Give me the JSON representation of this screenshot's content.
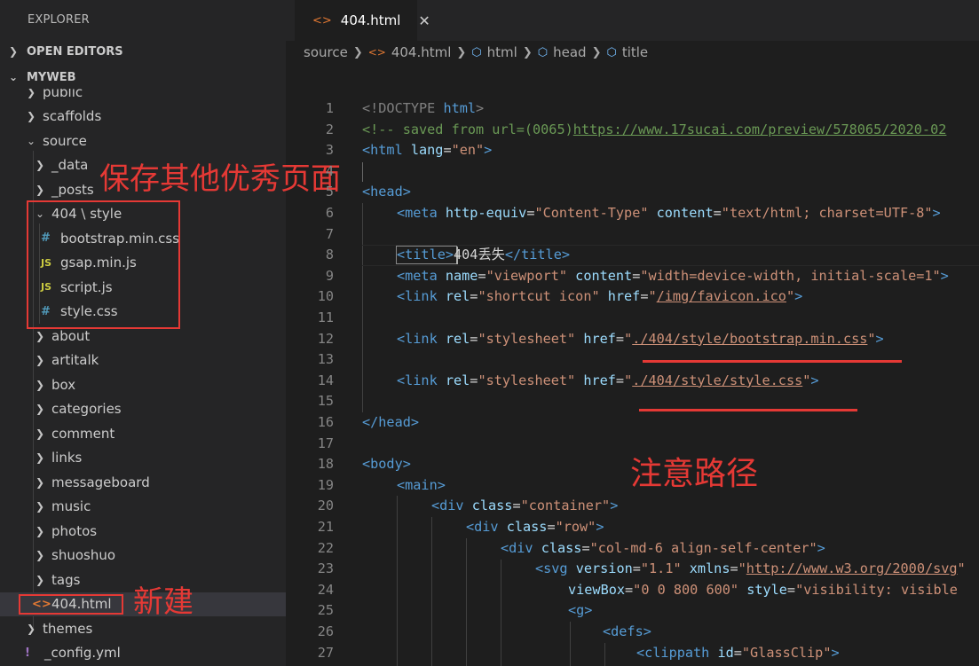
{
  "sidebar": {
    "title": "EXPLORER",
    "open_editors": "OPEN EDITORS",
    "project": "MYWEB",
    "tree": [
      {
        "label": "public",
        "type": "folder"
      },
      {
        "label": "scaffolds",
        "type": "folder"
      },
      {
        "label": "source",
        "type": "folder-open"
      },
      {
        "label": "_data",
        "type": "folder"
      },
      {
        "label": "_posts",
        "type": "folder"
      },
      {
        "label": "404 \\ style",
        "type": "folder-open"
      },
      {
        "label": "bootstrap.min.css",
        "type": "css",
        "icon": "#"
      },
      {
        "label": "gsap.min.js",
        "type": "js",
        "icon": "JS"
      },
      {
        "label": "script.js",
        "type": "js",
        "icon": "JS"
      },
      {
        "label": "style.css",
        "type": "css",
        "icon": "#"
      },
      {
        "label": "about",
        "type": "folder"
      },
      {
        "label": "artitalk",
        "type": "folder"
      },
      {
        "label": "box",
        "type": "folder"
      },
      {
        "label": "categories",
        "type": "folder"
      },
      {
        "label": "comment",
        "type": "folder"
      },
      {
        "label": "links",
        "type": "folder"
      },
      {
        "label": "messageboard",
        "type": "folder"
      },
      {
        "label": "music",
        "type": "folder"
      },
      {
        "label": "photos",
        "type": "folder"
      },
      {
        "label": "shuoshuo",
        "type": "folder"
      },
      {
        "label": "tags",
        "type": "folder"
      },
      {
        "label": "404.html",
        "type": "html",
        "icon": "<>"
      },
      {
        "label": "themes",
        "type": "folder"
      },
      {
        "label": "_config.yml",
        "type": "yml",
        "icon": "!"
      }
    ]
  },
  "annotations": {
    "save_note": "保存其他优秀页面",
    "new_note": "新建",
    "path_note": "注意路径",
    "color": "#e53935"
  },
  "editor": {
    "tab_label": "404.html",
    "tab_icon": "<>",
    "close_icon": "✕",
    "breadcrumb": [
      "source",
      "404.html",
      "html",
      "head",
      "title"
    ],
    "line_numbers": [
      "1",
      "2",
      "3",
      "4",
      "5",
      "6",
      "7",
      "8",
      "9",
      "10",
      "11",
      "12",
      "13",
      "14",
      "15",
      "16",
      "17",
      "18",
      "19",
      "20",
      "21",
      "22",
      "23",
      "24",
      "25",
      "26",
      "27"
    ]
  },
  "code": {
    "l1_doctype": "<!DOCTYPE",
    "l1_html": " html",
    "l1_end": ">",
    "l2_comment": "<!-- saved from url=(0065)",
    "l2_url": "https://www.17sucai.com/preview/578065/2020-02",
    "l3_open": "<html",
    "l3_attr": " lang",
    "l3_eq": "=",
    "l3_val": "\"en\"",
    "l3_end": ">",
    "l5": "<head>",
    "l6_tag": "<meta",
    "l6_a1": " http-equiv",
    "l6_v1": "\"Content-Type\"",
    "l6_a2": " content",
    "l6_v2": "\"text/html; charset=UTF-8\"",
    "l6_end": ">",
    "l8_open": "<title>",
    "l8_text": "404丢失",
    "l8_close": "</title>",
    "l9_tag": "<meta",
    "l9_a1": " name",
    "l9_v1": "\"viewport\"",
    "l9_a2": " content",
    "l9_v2": "\"width=device-width, initial-scale=1\"",
    "l9_end": ">",
    "l10_tag": "<link",
    "l10_a1": " rel",
    "l10_v1": "\"shortcut icon\"",
    "l10_a2": " href",
    "l10_q": "\"",
    "l10_v2": "/img/favicon.ico",
    "l10_end": ">",
    "l12_tag": "<link",
    "l12_a1": " rel",
    "l12_v1": "\"stylesheet\"",
    "l12_a2": " href",
    "l12_q": "\"",
    "l12_v2": "./404/style/bootstrap.min.css",
    "l12_end": ">",
    "l14_tag": "<link",
    "l14_a1": " rel",
    "l14_v1": "\"stylesheet\"",
    "l14_a2": " href",
    "l14_q": "\"",
    "l14_v2": "./404/style/style.css",
    "l14_end": ">",
    "l16": "</head>",
    "l18": "<body>",
    "l19": "<main>",
    "l20_tag": "<div",
    "l20_a": " class",
    "l20_v": "\"container\"",
    "l20_end": ">",
    "l21_tag": "<div",
    "l21_a": " class",
    "l21_v": "\"row\"",
    "l21_end": ">",
    "l22_tag": "<div",
    "l22_a": " class",
    "l22_v": "\"col-md-6 align-self-center\"",
    "l22_end": ">",
    "l23_tag": "<svg",
    "l23_a1": " version",
    "l23_v1": "\"1.1\"",
    "l23_a2": " xmlns",
    "l23_q": "\"",
    "l23_v2": "http://www.w3.org/2000/svg",
    "l23_end": "\"",
    "l24_a1": "viewBox",
    "l24_v1": "\"0 0 800 600\"",
    "l24_a2": " style",
    "l24_v2": "\"visibility: visible",
    "l25": "<g>",
    "l26": "<defs>",
    "l27_tag": "<clippath",
    "l27_a": " id",
    "l27_v": "\"GlassClip\"",
    "l27_end": ">",
    "eq": "="
  }
}
